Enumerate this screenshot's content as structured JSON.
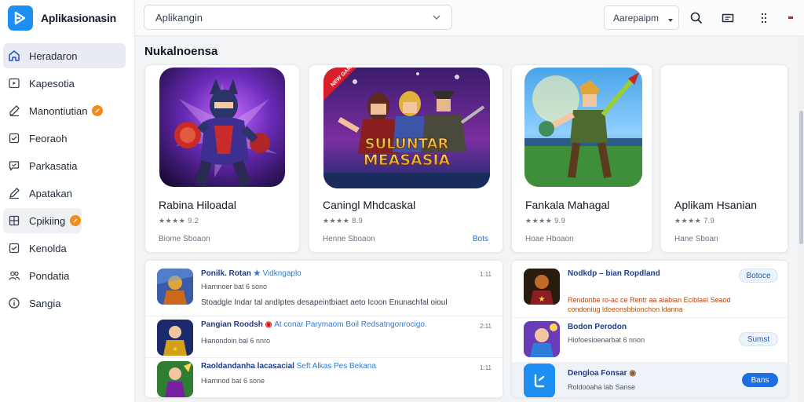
{
  "app": {
    "name": "Aplikasionasin",
    "brand_color": "#1d8ff2"
  },
  "sidebar": {
    "items": [
      {
        "label": "Heradaron",
        "icon": "home-icon",
        "active": true
      },
      {
        "label": "Kapesotia",
        "icon": "play-box-icon"
      },
      {
        "label": "Manontiutian",
        "icon": "edit-icon",
        "badge": true
      },
      {
        "label": "Feoraoh",
        "icon": "checkbox-icon"
      },
      {
        "label": "Parkasatia",
        "icon": "message-check-icon"
      },
      {
        "label": "Apatakan",
        "icon": "pencil-icon"
      },
      {
        "label": "Cpikiing",
        "icon": "grid-icon",
        "badge": true
      },
      {
        "label": "Kenolda",
        "icon": "checkbox-icon"
      },
      {
        "label": "Pondatia",
        "icon": "users-icon"
      },
      {
        "label": "Sangia",
        "icon": "info-icon"
      }
    ]
  },
  "topbar": {
    "search_value": "Aplikangin",
    "language_value": "Aarepaipm"
  },
  "section": {
    "title": "Nukalnoensa"
  },
  "cards": [
    {
      "title": "Rabina Hiloadal",
      "rating": "★★★★ 9.2",
      "meta": "Biome Sboaon",
      "link": ""
    },
    {
      "title": "Caningl Mhdcaskal",
      "rating": "★★★★ 8.9",
      "meta": "Henne Sboaon",
      "link": "Bots"
    },
    {
      "title": "Fankala Mahagal",
      "rating": "★★★★ 9.9",
      "meta": "Hoae Hboaon",
      "link": ""
    },
    {
      "title": "Aplikam Hsanian",
      "rating": "★★★★ 7.9",
      "meta": "Hane Sboan",
      "link": ""
    }
  ],
  "thumb_texts": {
    "game_logo_line1": "SULUNTAR",
    "game_logo_line2": "MEASASIA",
    "ribbon": "NEW GAME"
  },
  "left_list": [
    {
      "title": "Ponilk. Rotan",
      "accent": "Vidkngaplo",
      "sub": "Hiarnnoer bat  6 sono",
      "desc": "Stoadgle Indar tal andIptes desapeintbiaet aeto Icoon Enunachfal oioul",
      "time": "1:11"
    },
    {
      "title": "Pangian Roodsh",
      "accent": "At conar Parymaom  Boil Redsatngonrocigo.",
      "sub": "Hianondoin bal  6 nnro",
      "desc": "",
      "time": "2:11"
    },
    {
      "title": "Raoldandanha lacasacial",
      "accent": "Seft Alkas Pes Bekana",
      "sub": "Hiarnnod bat  6 sone",
      "desc": "",
      "time": "1:11"
    }
  ],
  "right_list": [
    {
      "title": "Nodkdp  –  bian Ropdland",
      "desc": "Rendonbe ro-ac ce Rentr aa alabian Eciblael Seaod",
      "desc2": "condoniug ldoeonsbbionchon ldanna",
      "sub": "",
      "button": "Botoce"
    },
    {
      "title": "Bodon Perodon",
      "desc": "",
      "desc2": "",
      "sub": "Hiofoesioenarbat  6 nnon",
      "button": "Sumst"
    },
    {
      "title": "Dengloa Fonsar",
      "desc": "",
      "desc2": "",
      "sub": "Roldooaha lab  Sanse",
      "button": "Bans"
    }
  ]
}
